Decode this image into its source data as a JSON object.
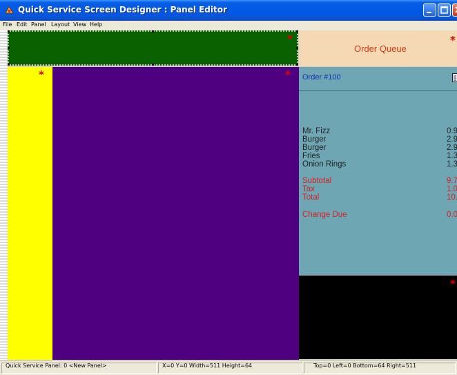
{
  "window": {
    "title": "Quick Service Screen Designer : Panel Editor"
  },
  "menu": [
    "File",
    "Edit",
    "Panel",
    "Layout",
    "View",
    "Help"
  ],
  "zones": {
    "header_marker": "*",
    "rail_marker": "*",
    "main_marker": "*",
    "queue_marker": "*",
    "footer_marker": "*"
  },
  "order_queue": {
    "label": "Order Queue"
  },
  "order": {
    "number": "Order #100",
    "items": [
      {
        "name": "Mr. Fizz",
        "price": "0.9"
      },
      {
        "name": "Burger",
        "price": "2.9"
      },
      {
        "name": "Burger",
        "price": "2.9"
      },
      {
        "name": "Fries",
        "price": "1.3"
      },
      {
        "name": "Onion Rings",
        "price": "1.3"
      }
    ],
    "subtotal_label": "Subtotal",
    "subtotal_value": "9.7",
    "tax_label": "Tax",
    "tax_value": "1.0",
    "total_label": "Total",
    "total_value": "10.7",
    "change_label": "Change Due",
    "change_value": "0.0"
  },
  "status": {
    "panel": "Quick Service Panel: 0 <New Panel>",
    "position": "X=0 Y=0 Width=511 Height=64",
    "bounds": "Top=0 Left=0 Bottom=64 Right=511"
  },
  "colors": {
    "header_zone": "#0a6100",
    "side_zone": "#ffff00",
    "main_zone": "#4e0080",
    "queue_zone": "#f5d9b5",
    "order_zone": "#6ea6b4",
    "marker": "#e00000"
  }
}
